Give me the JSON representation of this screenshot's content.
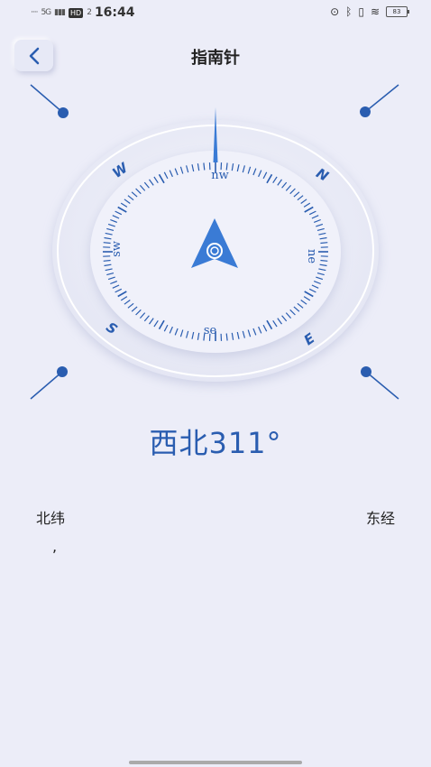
{
  "status_bar": {
    "signal_text": "5G",
    "hd_badge": "HD",
    "hd_sub": "2",
    "time": "16:44",
    "battery": "83",
    "icons": [
      "location-icon",
      "bluetooth-icon",
      "vibrate-icon",
      "wifi-icon",
      "battery-icon"
    ]
  },
  "header": {
    "title": "指南针",
    "back_icon": "chevron-left-icon"
  },
  "compass": {
    "cardinals": {
      "north": "N",
      "east": "E",
      "south": "S",
      "west": "W"
    },
    "intercardinals": {
      "nw": "nw",
      "ne": "ne",
      "se": "se",
      "sw": "sw"
    },
    "heading_degrees": 311,
    "accent_color": "#2a5db0",
    "pointer_color": "#3a7bd5"
  },
  "heading_text": "西北311°",
  "location": {
    "latitude_label": "北纬",
    "longitude_label": "东经",
    "latitude_value": ","
  }
}
